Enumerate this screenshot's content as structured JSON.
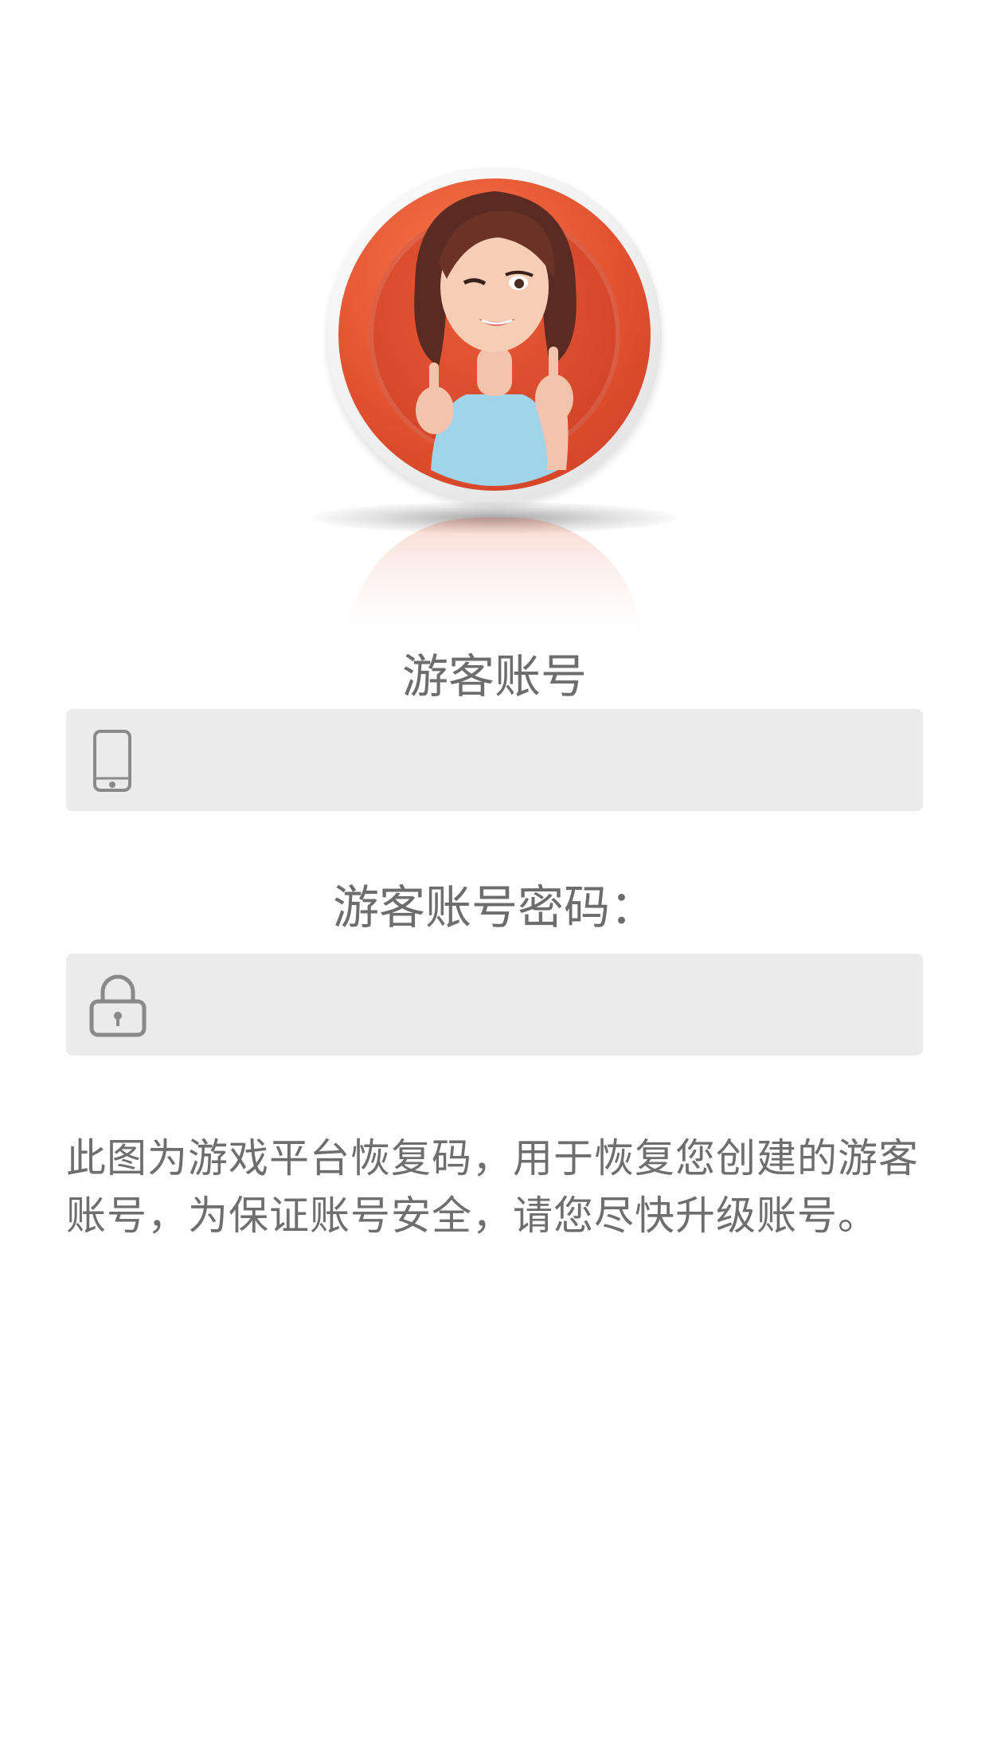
{
  "avatar": {
    "icon": "avatar-character-image"
  },
  "account": {
    "label": "游客账号",
    "value": "",
    "placeholder": "",
    "icon": "phone-icon"
  },
  "password": {
    "label": "游客账号密码：",
    "value": "",
    "placeholder": "",
    "icon": "lock-icon"
  },
  "description": "此图为游戏平台恢复码，用于恢复您创建的游客账号，为保证账号安全，请您尽快升级账号。",
  "colors": {
    "field_background": "#ebebeb",
    "text": "#6e6e6e",
    "avatar_ring": "#e2512f",
    "icon": "#8a8a8a"
  }
}
